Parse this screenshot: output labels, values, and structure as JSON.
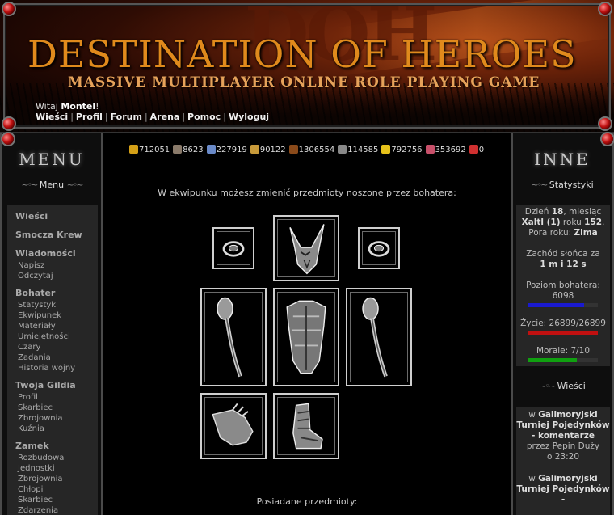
{
  "header": {
    "title": "Destination of Heroes",
    "subtitle": "Massive Multiplayer Online Role Playing Game",
    "ghost_letters": "DOH",
    "welcome_prefix": "Witaj ",
    "username": "Montel",
    "welcome_suffix": "!",
    "nav": [
      "Wieści",
      "Profil",
      "Forum",
      "Arena",
      "Pomoc",
      "Wyloguj"
    ]
  },
  "left": {
    "bar_title": "MENU",
    "section_title": "Menu",
    "menu": [
      {
        "label": "Wieści",
        "items": []
      },
      {
        "label": "Smocza Krew",
        "items": []
      },
      {
        "label": "Wiadomości",
        "items": [
          "Napisz",
          "Odczytaj"
        ]
      },
      {
        "label": "Bohater",
        "items": [
          "Statystyki",
          "Ekwipunek",
          "Materiały",
          "Umiejętności",
          "Czary",
          "Zadania",
          "Historia wojny"
        ]
      },
      {
        "label": "Twoja Gildia",
        "items": [
          "Profil",
          "Skarbiec",
          "Zbrojownia",
          "Kuźnia"
        ]
      },
      {
        "label": "Zamek",
        "items": [
          "Rozbudowa",
          "Jednostki",
          "Zbrojownia",
          "Chłopi",
          "Skarbiec",
          "Zdarzenia"
        ]
      }
    ]
  },
  "resources": [
    {
      "icon": "gold-icon",
      "value": "712051",
      "color": "#d4a017"
    },
    {
      "icon": "hourglass-icon",
      "value": "8623",
      "color": "#8a7a6a"
    },
    {
      "icon": "mana-orb-icon",
      "value": "227919",
      "color": "#6a8ac8"
    },
    {
      "icon": "population-icon",
      "value": "90122",
      "color": "#c89a3a"
    },
    {
      "icon": "wood-icon",
      "value": "1306554",
      "color": "#8a4a1a"
    },
    {
      "icon": "stone-icon",
      "value": "114585",
      "color": "#888888"
    },
    {
      "icon": "sulfur-icon",
      "value": "792756",
      "color": "#e6c21a"
    },
    {
      "icon": "gems-icon",
      "value": "353692",
      "color": "#c8506a"
    },
    {
      "icon": "potion-icon",
      "value": "0",
      "color": "#d03030"
    }
  ],
  "center": {
    "intro": "W ekwipunku możesz zmienić przedmioty noszone przez bohatera:",
    "owned_label": "Posiadane przedmioty:"
  },
  "right": {
    "bar_title": "INNE",
    "stats_title": "Statystyki",
    "date_prefix": "Dzień ",
    "day": "18",
    "date_mid": ", miesiąc ",
    "month": "Xaltl (1)",
    "year_mid": " roku ",
    "year": "152",
    "year_suffix": ".",
    "season_label": "Pora roku: ",
    "season": "Zima",
    "sunset_label": "Zachód słońca za",
    "sunset_time": "1 m i 12 s",
    "level_label": "Poziom bohatera: 6098",
    "level_fraction": 0.8,
    "life_label": "Życie: 26899/26899",
    "life_fraction": 1.0,
    "morale_label": "Morale: 7/10",
    "morale_fraction": 0.7,
    "colors": {
      "level": "#1a1ad0",
      "life": "#c01010",
      "morale": "#10a010"
    },
    "news_title": "Wieści",
    "news": [
      {
        "prefix": "w ",
        "topic": "Galimoryjski Turniej Pojedynków - komentarze",
        "by": "przez Pepin Duży",
        "time": "o 23:20"
      },
      {
        "prefix": "w ",
        "topic": "Galimoryjski Turniej Pojedynków -",
        "by": "",
        "time": ""
      }
    ]
  },
  "equipment": [
    {
      "slot": "ring-left",
      "icon": "ring-icon"
    },
    {
      "slot": "helmet",
      "icon": "helmet-icon"
    },
    {
      "slot": "ring-right",
      "icon": "ring-icon"
    },
    {
      "slot": "weapon-left",
      "icon": "mace-icon"
    },
    {
      "slot": "armor",
      "icon": "armor-icon"
    },
    {
      "slot": "weapon-right",
      "icon": "mace-icon"
    },
    {
      "slot": "gloves",
      "icon": "gloves-icon"
    },
    {
      "slot": "boots",
      "icon": "boots-icon"
    }
  ]
}
